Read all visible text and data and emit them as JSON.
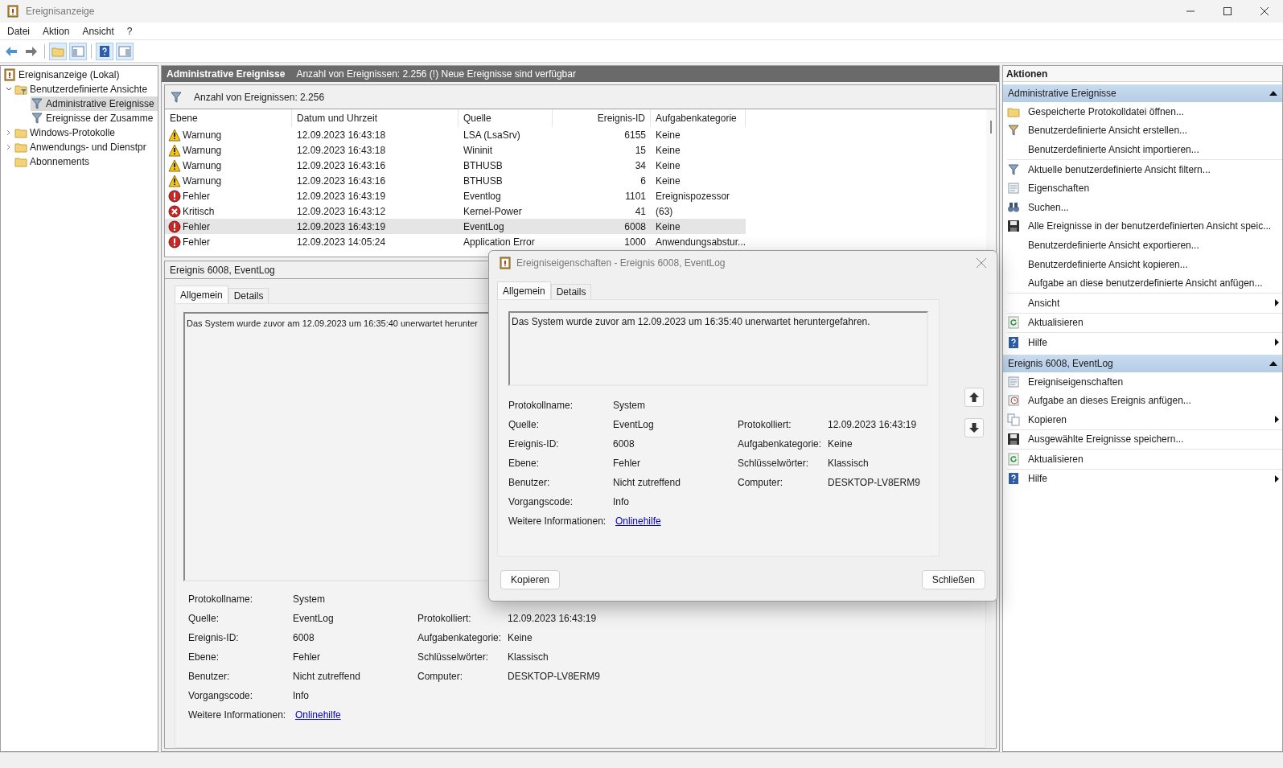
{
  "window": {
    "title": "Ereignisanzeige"
  },
  "menu": [
    "Datei",
    "Aktion",
    "Ansicht",
    "?"
  ],
  "toolbar": [
    {
      "kind": "back",
      "pressed": false
    },
    {
      "kind": "forward",
      "pressed": false
    },
    {
      "kind": "folder",
      "pressed": true
    },
    {
      "kind": "pane-left",
      "pressed": true
    },
    {
      "kind": "help",
      "pressed": true
    },
    {
      "kind": "pane-right",
      "pressed": true
    }
  ],
  "tree": [
    {
      "label": "Ereignisanzeige (Lokal)",
      "kind": "viewer",
      "selected": false,
      "children": [
        {
          "label": "Benutzerdefinierte Ansichte",
          "kind": "folder-filter",
          "expanded": true,
          "selected": false,
          "children": [
            {
              "label": "Administrative Ereignisse",
              "kind": "filter",
              "selected": true
            },
            {
              "label": "Ereignisse der Zusamme",
              "kind": "filter",
              "selected": false
            }
          ]
        },
        {
          "label": "Windows-Protokolle",
          "kind": "folder",
          "expanded": false,
          "selected": false
        },
        {
          "label": "Anwendungs- und Dienstpr",
          "kind": "folder",
          "expanded": false,
          "selected": false
        },
        {
          "label": "Abonnements",
          "kind": "folder",
          "selected": false
        }
      ]
    }
  ],
  "events": {
    "title": "Administrative Ereignisse",
    "info": "Anzahl von Ereignissen: 2.256 (!) Neue Ereignisse sind verfügbar",
    "filter": "Anzahl von Ereignissen: 2.256",
    "columns": [
      "Ebene",
      "Datum und Uhrzeit",
      "Quelle",
      "Ereignis-ID",
      "Aufgabenkategorie"
    ],
    "rows": [
      {
        "kind": "warning",
        "level": "Warnung",
        "date": "12.09.2023 16:43:18",
        "source": "LSA (LsaSrv)",
        "id": "6155",
        "category": "Keine",
        "selected": false
      },
      {
        "kind": "warning",
        "level": "Warnung",
        "date": "12.09.2023 16:43:18",
        "source": "Wininit",
        "id": "15",
        "category": "Keine",
        "selected": false
      },
      {
        "kind": "warning",
        "level": "Warnung",
        "date": "12.09.2023 16:43:16",
        "source": "BTHUSB",
        "id": "34",
        "category": "Keine",
        "selected": false
      },
      {
        "kind": "warning",
        "level": "Warnung",
        "date": "12.09.2023 16:43:16",
        "source": "BTHUSB",
        "id": "6",
        "category": "Keine",
        "selected": false
      },
      {
        "kind": "error",
        "level": "Fehler",
        "date": "12.09.2023 16:43:19",
        "source": "Eventlog",
        "id": "1101",
        "category": "Ereignispozessor",
        "selected": false
      },
      {
        "kind": "critical",
        "level": "Kritisch",
        "date": "12.09.2023 16:43:12",
        "source": "Kernel-Power",
        "id": "41",
        "category": "(63)",
        "selected": false
      },
      {
        "kind": "error",
        "level": "Fehler",
        "date": "12.09.2023 16:43:19",
        "source": "EventLog",
        "id": "6008",
        "category": "Keine",
        "selected": true
      },
      {
        "kind": "error",
        "level": "Fehler",
        "date": "12.09.2023 14:05:24",
        "source": "Application Error",
        "id": "1000",
        "category": "Anwendungsabstur...",
        "selected": false
      }
    ]
  },
  "detail": {
    "title": "Ereignis 6008, EventLog",
    "tabs": [
      {
        "label": "Allgemein",
        "selected": true
      },
      {
        "label": "Details",
        "selected": false
      }
    ],
    "description": "Das System wurde zuvor am 12.09.2023 um 16:35:40 unerwartet herunter",
    "left": [
      {
        "kind": "text",
        "label": "Protokollname:",
        "value": "System"
      },
      {
        "kind": "text",
        "label": "Quelle:",
        "value": "EventLog"
      },
      {
        "kind": "text",
        "label": "Ereignis-ID:",
        "value": "6008"
      },
      {
        "kind": "text",
        "label": "Ebene:",
        "value": "Fehler"
      },
      {
        "kind": "text",
        "label": "Benutzer:",
        "value": "Nicht zutreffend"
      },
      {
        "kind": "text",
        "label": "Vorgangscode:",
        "value": "Info"
      },
      {
        "kind": "link",
        "label": "Weitere Informationen:",
        "value": "Onlinehilfe"
      }
    ],
    "right": [
      {
        "label": "Protokolliert:",
        "value": "12.09.2023 16:43:19"
      },
      {
        "label": "Aufgabenkategorie:",
        "value": "Keine"
      },
      {
        "label": "Schlüsselwörter:",
        "value": "Klassisch"
      },
      {
        "label": "Computer:",
        "value": "DESKTOP-LV8ERM9"
      }
    ]
  },
  "actions": {
    "title": "Aktionen",
    "sections": [
      {
        "title": "Administrative Ereignisse",
        "expanded": true,
        "groups": [
          [
            {
              "label": "Gespeicherte Protokolldatei öffnen...",
              "kind": "folder",
              "submenu": false
            },
            {
              "label": "Benutzerdefinierte Ansicht erstellen...",
              "kind": "funnel-new",
              "submenu": false
            },
            {
              "label": "Benutzerdefinierte Ansicht importieren...",
              "kind": "plain",
              "submenu": false
            }
          ],
          [
            {
              "label": "Aktuelle benutzerdefinierte Ansicht filtern...",
              "kind": "funnel",
              "submenu": false
            },
            {
              "label": "Eigenschaften",
              "kind": "properties",
              "submenu": false
            },
            {
              "label": "Suchen...",
              "kind": "binoculars",
              "submenu": false
            },
            {
              "label": "Alle Ereignisse in der benutzerdefinierten Ansicht speic...",
              "kind": "save",
              "submenu": false
            },
            {
              "label": "Benutzerdefinierte Ansicht exportieren...",
              "kind": "plain",
              "submenu": false
            },
            {
              "label": "Benutzerdefinierte Ansicht kopieren...",
              "kind": "plain",
              "submenu": false
            },
            {
              "label": "Aufgabe an diese benutzerdefinierte Ansicht anfügen...",
              "kind": "plain",
              "submenu": false
            }
          ],
          [
            {
              "label": "Ansicht",
              "kind": "plain",
              "submenu": true
            }
          ],
          [
            {
              "label": "Aktualisieren",
              "kind": "refresh",
              "submenu": false
            }
          ],
          [
            {
              "label": "Hilfe",
              "kind": "help",
              "submenu": true
            }
          ]
        ]
      },
      {
        "title": "Ereignis 6008, EventLog",
        "expanded": true,
        "groups": [
          [
            {
              "label": "Ereigniseigenschaften",
              "kind": "properties",
              "submenu": false
            },
            {
              "label": "Aufgabe an dieses Ereignis anfügen...",
              "kind": "task",
              "submenu": false
            },
            {
              "label": "Kopieren",
              "kind": "copy",
              "submenu": true
            }
          ],
          [
            {
              "label": "Ausgewählte Ereignisse speichern...",
              "kind": "save",
              "submenu": false
            }
          ],
          [
            {
              "label": "Aktualisieren",
              "kind": "refresh",
              "submenu": false
            }
          ],
          [
            {
              "label": "Hilfe",
              "kind": "help",
              "submenu": true
            }
          ]
        ]
      }
    ]
  },
  "dialog": {
    "title": "Ereigniseigenschaften - Ereignis 6008, EventLog",
    "tabs": [
      {
        "label": "Allgemein",
        "selected": true
      },
      {
        "label": "Details",
        "selected": false
      }
    ],
    "description": "Das System wurde zuvor am 12.09.2023 um 16:35:40 unerwartet heruntergefahren.",
    "left": [
      {
        "kind": "text",
        "label": "Protokollname:",
        "value": "System"
      },
      {
        "kind": "text",
        "label": "Quelle:",
        "value": "EventLog"
      },
      {
        "kind": "text",
        "label": "Ereignis-ID:",
        "value": "6008"
      },
      {
        "kind": "text",
        "label": "Ebene:",
        "value": "Fehler"
      },
      {
        "kind": "text",
        "label": "Benutzer:",
        "value": "Nicht zutreffend"
      },
      {
        "kind": "text",
        "label": "Vorgangscode:",
        "value": "Info"
      },
      {
        "kind": "link",
        "label": "Weitere Informationen:",
        "value": "Onlinehilfe"
      }
    ],
    "right": [
      {
        "label": "Protokolliert:",
        "value": "12.09.2023 16:43:19"
      },
      {
        "label": "Aufgabenkategorie:",
        "value": "Keine"
      },
      {
        "label": "Schlüsselwörter:",
        "value": "Klassisch"
      },
      {
        "label": "Computer:",
        "value": "DESKTOP-LV8ERM9"
      }
    ],
    "buttons": [
      "Kopieren",
      "Schließen"
    ]
  }
}
